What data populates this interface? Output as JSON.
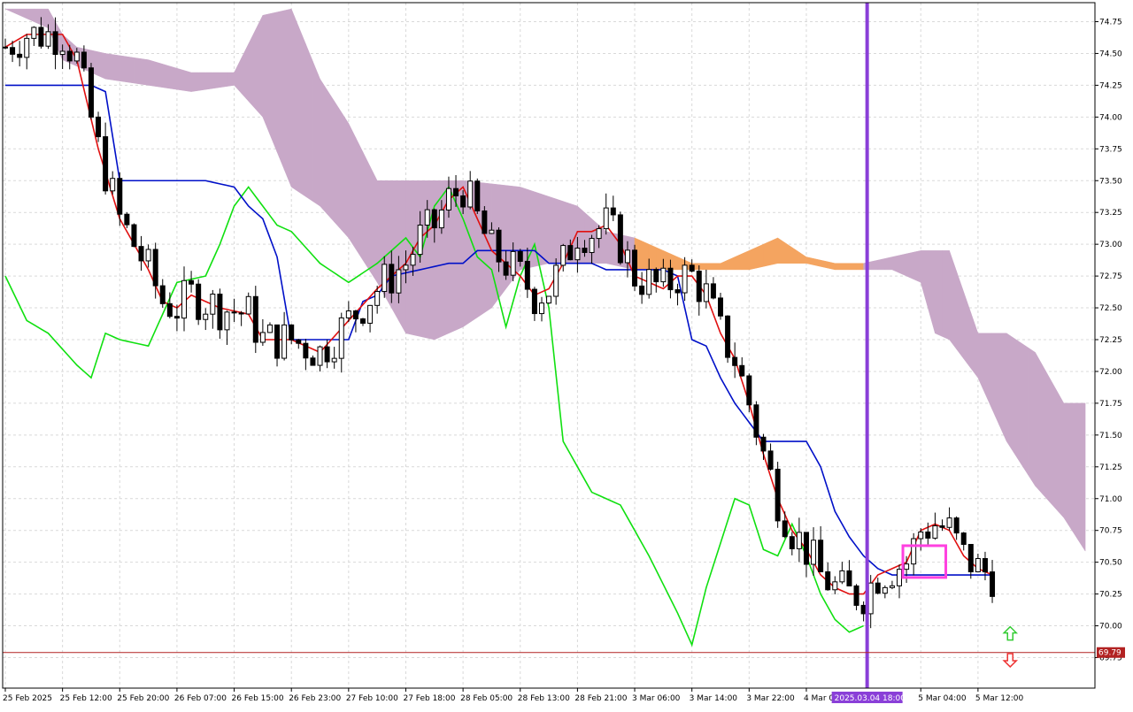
{
  "chart_data": {
    "type": "candlestick",
    "title": "",
    "colors": {
      "background": "#ffffff",
      "grid": "#d9d9d9",
      "candle_up_fill": "#ffffff",
      "candle_down_fill": "#000000",
      "tenkan": "#e01010",
      "kijun": "#0010c8",
      "chikou": "#10e010",
      "cloud_bear": "#c8a8c8",
      "cloud_bull": "#f4a460",
      "vline": "#8a3fd8",
      "hline": "#b22222",
      "price_label_bg": "#b22222",
      "highlight_box": "#ff40e0",
      "arrow_up": "#33cc33",
      "arrow_down": "#ee3333"
    },
    "y_axis": {
      "range": [
        69.6,
        74.85
      ],
      "ticks": [
        "74.75",
        "74.50",
        "74.25",
        "74.00",
        "73.75",
        "73.50",
        "73.25",
        "73.00",
        "72.75",
        "72.50",
        "72.25",
        "72.00",
        "71.75",
        "71.50",
        "71.25",
        "71.00",
        "70.75",
        "70.50",
        "70.25",
        "70.00",
        "69.75"
      ]
    },
    "x_axis": {
      "bar_count": 152,
      "tick_labels": [
        {
          "bar": 0,
          "label": "25 Feb 2025"
        },
        {
          "bar": 8,
          "label": "25 Feb 12:00"
        },
        {
          "bar": 16,
          "label": "25 Feb 20:00"
        },
        {
          "bar": 24,
          "label": "26 Feb 07:00"
        },
        {
          "bar": 32,
          "label": "26 Feb 15:00"
        },
        {
          "bar": 40,
          "label": "26 Feb 23:00"
        },
        {
          "bar": 48,
          "label": "27 Feb 10:00"
        },
        {
          "bar": 56,
          "label": "27 Feb 18:00"
        },
        {
          "bar": 64,
          "label": "28 Feb 05:00"
        },
        {
          "bar": 72,
          "label": "28 Feb 13:00"
        },
        {
          "bar": 80,
          "label": "28 Feb 21:00"
        },
        {
          "bar": 88,
          "label": "3 Mar 06:00"
        },
        {
          "bar": 96,
          "label": "3 Mar 14:00"
        },
        {
          "bar": 104,
          "label": "3 Mar 22:00"
        },
        {
          "bar": 112,
          "label": "4 Mar 0"
        },
        {
          "bar": 128,
          "label": "5 Mar 04:00"
        },
        {
          "bar": 136,
          "label": "5 Mar 12:00"
        }
      ]
    },
    "current_price": {
      "value": 69.79,
      "label": "69.79"
    },
    "vline": {
      "bar": 120.5,
      "label": "2025.03.04 18:00"
    },
    "highlight_box": {
      "bar_from": 125.5,
      "bar_to": 131.5,
      "price_from": 70.38,
      "price_to": 70.63
    },
    "arrows": [
      {
        "type": "up",
        "bar": 140.5,
        "price": 69.93
      },
      {
        "type": "down",
        "bar": 140.5,
        "price": 69.74
      }
    ],
    "candles": [],
    "tenkan": [],
    "kijun": [],
    "chikou": [],
    "cloud": []
  }
}
